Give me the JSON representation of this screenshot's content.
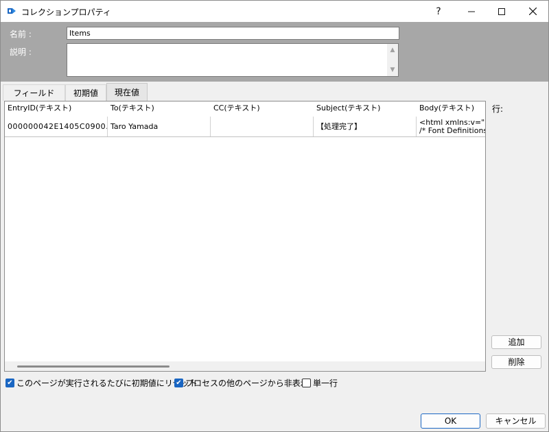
{
  "window": {
    "title": "コレクションプロパティ",
    "help": "?",
    "minimize": "—",
    "maximize": "☐",
    "close": "✕"
  },
  "header": {
    "name_label": "名前 :",
    "name_value": "Items",
    "desc_label": "説明 :",
    "desc_value": ""
  },
  "tabs": [
    {
      "label": "フィールド",
      "active": false
    },
    {
      "label": "初期値",
      "active": false
    },
    {
      "label": "現在値",
      "active": true
    }
  ],
  "grid": {
    "columns": [
      "EntryID(テキスト)",
      "To(テキスト)",
      "CC(テキスト)",
      "Subject(テキスト)",
      "Body(テキスト)"
    ],
    "rows": [
      {
        "entry_id": "000000042E1405C0900…",
        "to": "Taro Yamada",
        "cc": "",
        "subject": "【処理完了】",
        "body_line1": "<html xmlns:v=\"urn",
        "body_line2": "/* Font Definitions"
      }
    ]
  },
  "side": {
    "rows_label": "行:",
    "add": "追加",
    "delete": "削除"
  },
  "options": {
    "reset_label": "このページが実行されるたびに初期値にリセット",
    "reset_checked": true,
    "hide_label": "プロセスの他のページから非表示",
    "hide_checked": true,
    "single_label": "単一行",
    "single_checked": false
  },
  "footer": {
    "ok": "OK",
    "cancel": "キャンセル"
  },
  "colors": {
    "accent": "#1a66c2",
    "header_bg": "#a7a7a7"
  }
}
